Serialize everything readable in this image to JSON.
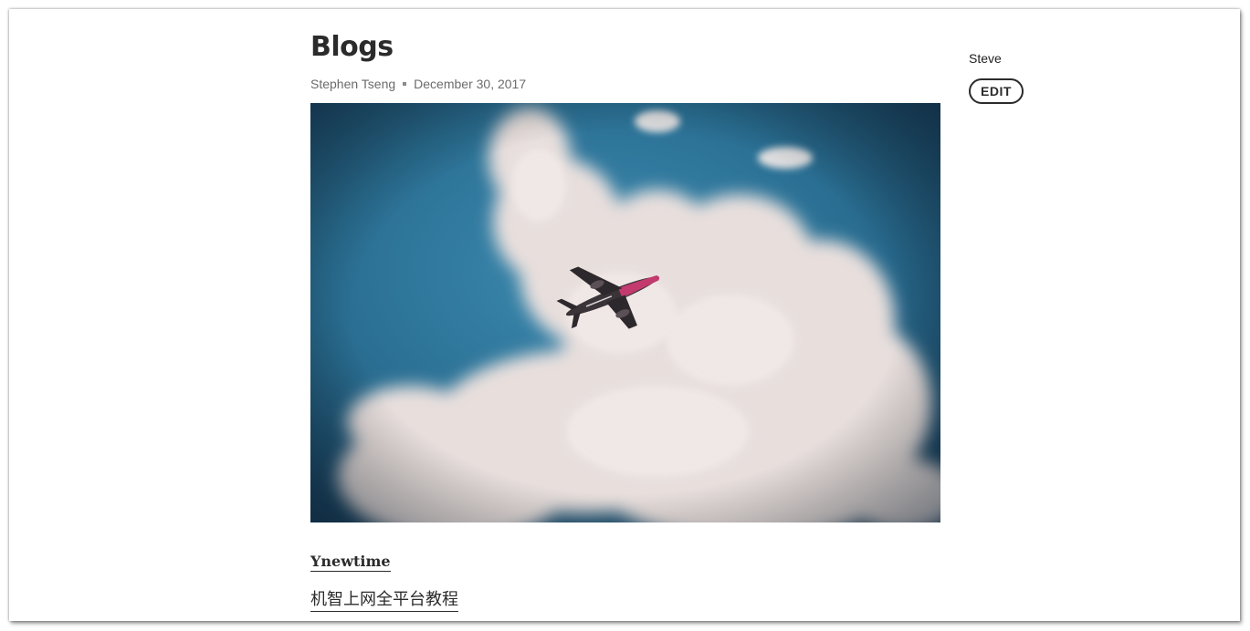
{
  "page": {
    "title": "Blogs"
  },
  "meta": {
    "author": "Stephen Tseng",
    "date": "December 30, 2017"
  },
  "hero_image": {
    "description_icon": "airplane-in-cloudy-sky",
    "sky_color": "#2a6f93",
    "cloud_color": "#ece4e2",
    "plane_accent": "#c23a6e"
  },
  "posts": [
    {
      "label": "Ynewtime"
    },
    {
      "label": "机智上网全平台教程"
    }
  ],
  "sidebar": {
    "user": "Steve",
    "edit_label": "EDIT"
  }
}
